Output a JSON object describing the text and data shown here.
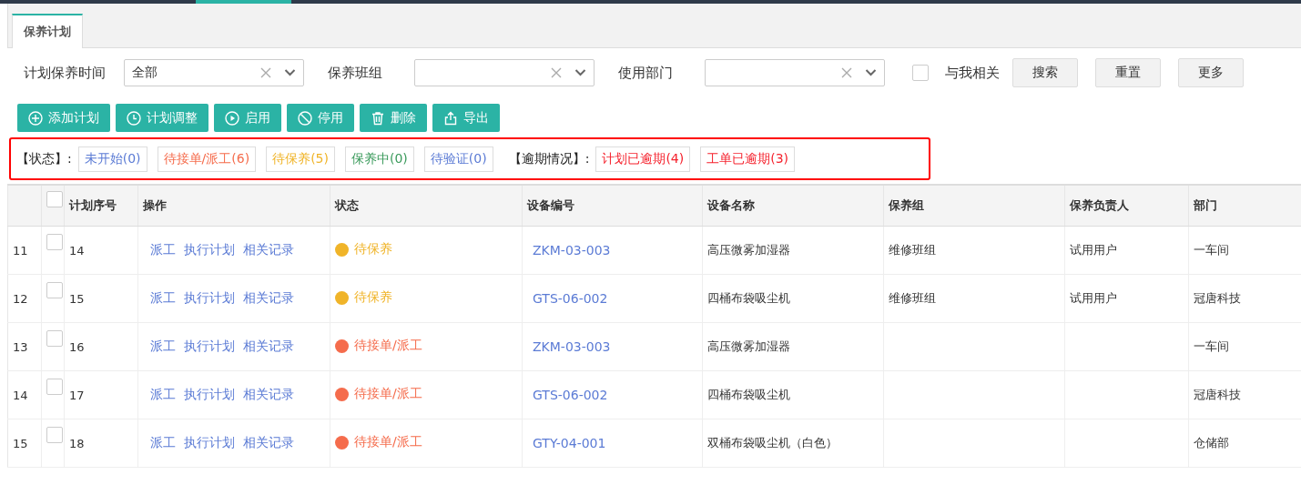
{
  "tabs": [
    {
      "label": "保养计划",
      "selected": true
    }
  ],
  "filters": [
    {
      "label": "计划保养时间",
      "value": "全部"
    },
    {
      "label": "保养班组"
    },
    {
      "label": "使用部门"
    }
  ],
  "related": {
    "label": "与我相关",
    "checked": false
  },
  "filter_buttons": [
    "搜索",
    "重置",
    "更多"
  ],
  "toolbar": [
    "添加计划",
    "计划调整",
    "启用",
    "停用",
    "删除",
    "导出"
  ],
  "status_label": "【状态】:",
  "status_tags": [
    {
      "label": "未开始(0)",
      "color": "#5b7bd5"
    },
    {
      "label": "待接单/派工(6)",
      "color": "#f56c4c"
    },
    {
      "label": "待保养(5)",
      "color": "#f0b429"
    },
    {
      "label": "保养中(0)",
      "color": "#3a9a5b"
    },
    {
      "label": "待验证(0)",
      "color": "#5b7bd5"
    }
  ],
  "overdue_label": "【逾期情况】:",
  "overdue_tags": [
    {
      "label": "计划已逾期(4)",
      "color": "#f5222d"
    },
    {
      "label": "工单已逾期(3)",
      "color": "#f5222d"
    }
  ],
  "table": {
    "header_checked": false,
    "columns": [
      "计划序号",
      "操作",
      "状态",
      "设备编号",
      "设备名称",
      "保养组",
      "保养负责人",
      "部门"
    ],
    "rows": [
      {
        "index": "11",
        "checked": false,
        "seq": "14",
        "actions": [
          "派工",
          "执行计划",
          "相关记录"
        ],
        "status": "待保养",
        "color": "#f0b429",
        "code": "ZKM-03-003",
        "name": "高压微雾加湿器",
        "group": "维修班组",
        "owner": "试用用户",
        "dept": "一车间"
      },
      {
        "index": "12",
        "checked": false,
        "seq": "15",
        "actions": [
          "派工",
          "执行计划",
          "相关记录"
        ],
        "status": "待保养",
        "color": "#f0b429",
        "code": "GTS-06-002",
        "name": "四桶布袋吸尘机",
        "group": "维修班组",
        "owner": "试用用户",
        "dept": "冠唐科技"
      },
      {
        "index": "13",
        "checked": false,
        "seq": "16",
        "actions": [
          "派工",
          "执行计划",
          "相关记录"
        ],
        "status": "待接单/派工",
        "color": "#f56c4c",
        "code": "ZKM-03-003",
        "name": "高压微雾加湿器",
        "dept": "一车间"
      },
      {
        "index": "14",
        "checked": false,
        "seq": "17",
        "actions": [
          "派工",
          "执行计划",
          "相关记录"
        ],
        "status": "待接单/派工",
        "color": "#f56c4c",
        "code": "GTS-06-002",
        "name": "四桶布袋吸尘机",
        "dept": "冠唐科技"
      },
      {
        "index": "15",
        "checked": false,
        "seq": "18",
        "actions": [
          "派工",
          "执行计划",
          "相关记录"
        ],
        "status": "待接单/派工",
        "color": "#f56c4c",
        "code": "GTY-04-001",
        "name": "双桶布袋吸尘机（白色）",
        "dept": "仓储部"
      }
    ]
  }
}
